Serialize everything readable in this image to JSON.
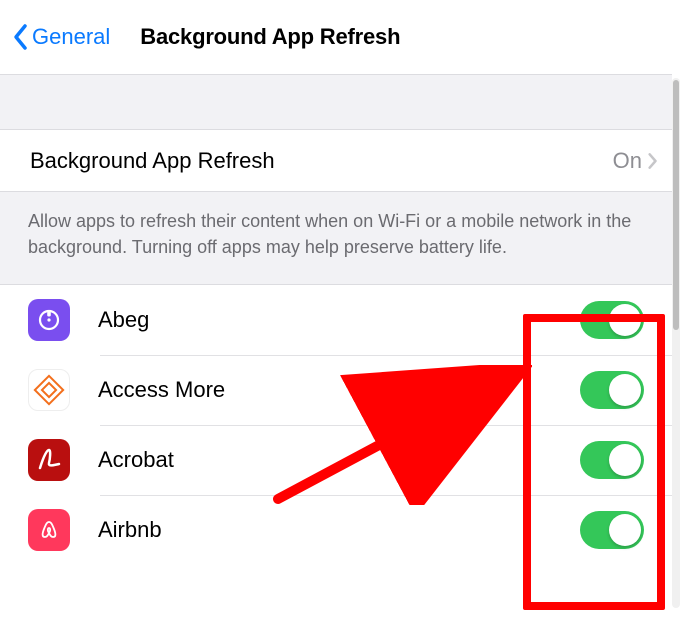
{
  "nav": {
    "back_label": "General",
    "title": "Background App Refresh"
  },
  "main_row": {
    "label": "Background App Refresh",
    "value": "On"
  },
  "footer": "Allow apps to refresh their content when on Wi-Fi or a mobile network in the background. Turning off apps may help preserve battery life.",
  "apps": [
    {
      "name": "Abeg",
      "enabled": true,
      "icon": "abeg"
    },
    {
      "name": "Access More",
      "enabled": true,
      "icon": "access"
    },
    {
      "name": "Acrobat",
      "enabled": true,
      "icon": "acrobat"
    },
    {
      "name": "Airbnb",
      "enabled": true,
      "icon": "airbnb"
    }
  ],
  "colors": {
    "accent": "#0a7aff",
    "switch_on": "#34c759",
    "annotation": "#ff0000"
  }
}
